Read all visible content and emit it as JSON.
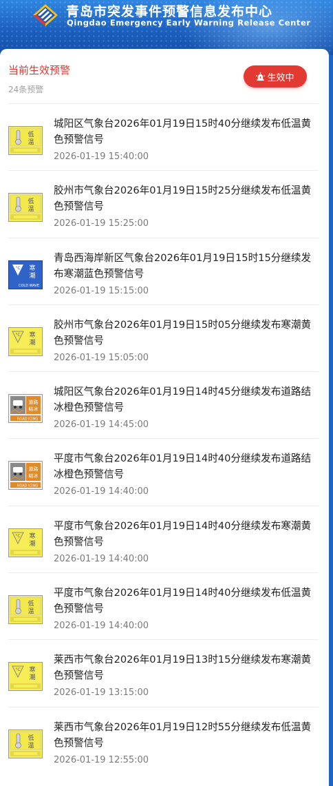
{
  "header": {
    "title_cn": "青岛市突发事件预警信息发布中心",
    "title_en": "Qingdao Emergency Early Warning Release Center"
  },
  "section": {
    "title": "当前生效预警",
    "count": "24条预警",
    "status_label": "生效中"
  },
  "colors": {
    "accent_red": "#e23a32",
    "yellow": "#f4e94a",
    "blue": "#2f63c8",
    "orange": "#e08a2a"
  },
  "warnings": [
    {
      "text": "城阳区气象台2026年01月19日15时40分继续发布低温黄色预警信号",
      "time": "2026-01-19 15:40:00",
      "icon": "low-temperature-yellow-warning-icon",
      "badge_label": "低温"
    },
    {
      "text": "胶州市气象台2026年01月19日15时25分继续发布低温黄色预警信号",
      "time": "2026-01-19 15:25:00",
      "icon": "low-temperature-yellow-warning-icon",
      "badge_label": "低温"
    },
    {
      "text": "青岛西海岸新区气象台2026年01月19日15时15分继续发布寒潮蓝色预警信号",
      "time": "2026-01-19 15:15:00",
      "icon": "cold-wave-blue-warning-icon",
      "badge_label": "寒潮",
      "badge_en": "COLD WAVE"
    },
    {
      "text": "胶州市气象台2026年01月19日15时05分继续发布寒潮黄色预警信号",
      "time": "2026-01-19 15:05:00",
      "icon": "cold-wave-yellow-warning-icon",
      "badge_label": "寒潮"
    },
    {
      "text": "城阳区气象台2026年01月19日14时45分继续发布道路结冰橙色预警信号",
      "time": "2026-01-19 14:45:00",
      "icon": "road-icing-orange-warning-icon",
      "badge_label": "道路结冰",
      "badge_en": "ROAD ICING"
    },
    {
      "text": "平度市气象台2026年01月19日14时40分继续发布道路结冰橙色预警信号",
      "time": "2026-01-19 14:40:00",
      "icon": "road-icing-orange-warning-icon",
      "badge_label": "道路结冰",
      "badge_en": "ROAD ICING"
    },
    {
      "text": "平度市气象台2026年01月19日14时40分继续发布寒潮黄色预警信号",
      "time": "2026-01-19 14:40:00",
      "icon": "cold-wave-yellow-warning-icon",
      "badge_label": "寒潮"
    },
    {
      "text": "平度市气象台2026年01月19日14时40分继续发布低温黄色预警信号",
      "time": "2026-01-19 14:40:00",
      "icon": "low-temperature-yellow-warning-icon",
      "badge_label": "低温"
    },
    {
      "text": "莱西市气象台2026年01月19日13时15分继续发布寒潮黄色预警信号",
      "time": "2026-01-19 13:15:00",
      "icon": "cold-wave-yellow-warning-icon",
      "badge_label": "寒潮"
    },
    {
      "text": "莱西市气象台2026年01月19日12时55分继续发布低温黄色预警信号",
      "time": "2026-01-19 12:55:00",
      "icon": "low-temperature-yellow-warning-icon",
      "badge_label": "低温"
    }
  ]
}
